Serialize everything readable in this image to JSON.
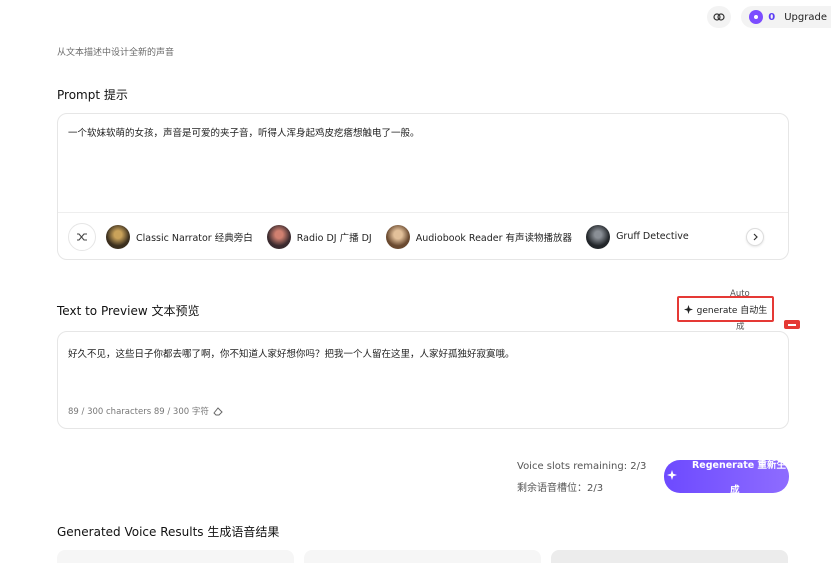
{
  "topbar": {
    "credits": "0",
    "upgrade_label": "Upgrade",
    "icons": [
      "brain-icon",
      "credit-icon"
    ]
  },
  "subtitle": "从文本描述中设计全新的声音",
  "prompt": {
    "label": "Prompt  提示",
    "text": "一个软妹软萌的女孩，声音是可爱的夹子音，听得人浑身起鸡皮疙瘩想触电了一般。",
    "presets": [
      {
        "label": "Classic Narrator  经典旁白",
        "color": "#3b2f1e"
      },
      {
        "label": "Radio DJ  广播 DJ",
        "color": "#5a3a3a"
      },
      {
        "label": "Audiobook Reader  有声读物播放器",
        "color": "#8a6a4a"
      },
      {
        "label": "Gruff Detective  ",
        "color": "#2e3338"
      }
    ]
  },
  "preview": {
    "label": "Text to Preview  文本预览",
    "text": "好久不见，这些日子你都去哪了啊，你不知道人家好想你吗？把我一个人留在这里，人家好孤独好寂寞哦。",
    "char_count": "89 / 300 characters  89 / 300 字符"
  },
  "auto_generate": {
    "top": "Auto",
    "label": "generate  自动生",
    "bottom": "成"
  },
  "slots": {
    "line1": "Voice slots remaining: 2/3",
    "line2": "剩余语音槽位：2/3"
  },
  "regenerate": {
    "label": "Regenerate  重新生",
    "label2": "成"
  },
  "results": {
    "label": "Generated Voice Results  生成语音结果"
  },
  "colors": {
    "accent": "#6d4aff",
    "highlight": "#e53935"
  }
}
